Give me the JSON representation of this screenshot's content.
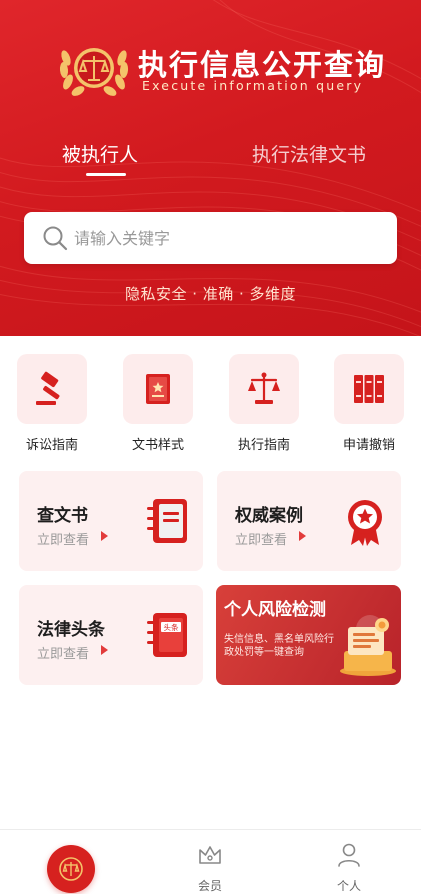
{
  "header": {
    "title": "执行信息公开查询",
    "subtitle": "Execute information query",
    "logo_icon": "scales-laurel-emblem-icon"
  },
  "tabs": [
    {
      "label": "被执行人",
      "active": true
    },
    {
      "label": "执行法律文书",
      "active": false
    }
  ],
  "search": {
    "placeholder": "请输入关键字",
    "value": "",
    "icon": "search-icon"
  },
  "slogan": "隐私安全 · 准确 · 多维度",
  "quick_links": [
    {
      "label": "诉讼指南",
      "icon": "gavel-icon"
    },
    {
      "label": "文书样式",
      "icon": "document-book-icon"
    },
    {
      "label": "执行指南",
      "icon": "scales-icon"
    },
    {
      "label": "申请撤销",
      "icon": "binders-icon"
    }
  ],
  "cards": [
    {
      "title": "查文书",
      "link": "立即查看",
      "icon": "notebook-icon"
    },
    {
      "title": "权威案例",
      "link": "立即查看",
      "icon": "award-badge-icon"
    },
    {
      "title": "法律头条",
      "link": "立即查看",
      "icon": "headline-notebook-icon",
      "badge": "头条"
    }
  ],
  "risk_card": {
    "title": "个人风险检测",
    "description": "失信信息、黑名单风险行政处罚等一键查询",
    "icon": "risk-document-icon"
  },
  "bottom_nav": [
    {
      "label": "",
      "icon": "home-emblem-icon",
      "active": true
    },
    {
      "label": "会员",
      "icon": "crown-icon",
      "active": false
    },
    {
      "label": "个人",
      "icon": "person-icon",
      "active": false
    }
  ],
  "colors": {
    "primary_red": "#d6211f",
    "hero_gradient_start": "#e0262b",
    "hero_gradient_end": "#c5141a",
    "card_background": "#fdf0f0",
    "icon_tile_background": "#fdecec",
    "gold": "#f4c36a"
  }
}
